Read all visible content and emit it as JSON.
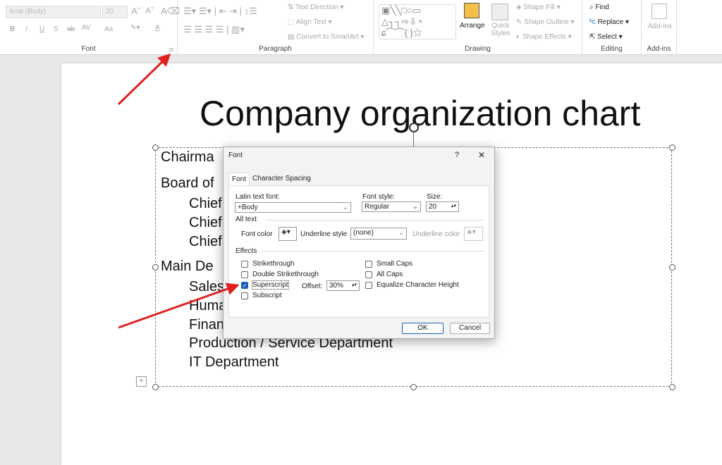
{
  "ribbon": {
    "font": {
      "font_name": "Arial (Body)",
      "font_size": "20",
      "label": "Font",
      "buttons": [
        "B",
        "I",
        "U",
        "S",
        "ab",
        "AV",
        "Aa",
        "A"
      ]
    },
    "paragraph": {
      "label": "Paragraph",
      "text_direction": "Text Direction",
      "align_text": "Align Text",
      "convert_smartart": "Convert to SmartArt"
    },
    "drawing": {
      "label": "Drawing",
      "arrange": "Arrange",
      "quick_styles": "Quick Styles",
      "shape_fill": "Shape Fill",
      "shape_outline": "Shape Outline",
      "shape_effects": "Shape Effects"
    },
    "editing": {
      "label": "Editing",
      "find": "Find",
      "replace": "Replace",
      "select": "Select"
    },
    "addins": {
      "label": "Add-ins",
      "button": "Add-ins"
    }
  },
  "slide": {
    "title": "Company organization chart",
    "lines": [
      {
        "text": "Chairma",
        "level": 0
      },
      {
        "text": "Board of",
        "level": 0
      },
      {
        "text": "Chief",
        "level": 1
      },
      {
        "text": "Chief",
        "level": 1
      },
      {
        "text": "Chief",
        "level": 1
      },
      {
        "text": "Main De",
        "level": 0
      },
      {
        "text": "Sales",
        "level": 1
      },
      {
        "text": "Huma",
        "level": 1
      },
      {
        "text": "Finan",
        "level": 1
      },
      {
        "text": "Production / Service Department",
        "level": 1
      },
      {
        "text": "IT Department",
        "level": 1
      }
    ]
  },
  "dialog": {
    "title": "Font",
    "help": "?",
    "close": "✕",
    "tabs": [
      "Font",
      "Character Spacing"
    ],
    "latin_font_label": "Latin text font:",
    "latin_font_value": "+Body",
    "font_style_label": "Font style:",
    "font_style_value": "Regular",
    "size_label": "Size:",
    "size_value": "20",
    "all_text_label": "All text",
    "font_color_label": "Font color",
    "underline_style_label": "Underline style",
    "underline_style_value": "(none)",
    "underline_color_label": "Underline color",
    "effects_label": "Effects",
    "effects": [
      {
        "label": "Strikethrough",
        "checked": false
      },
      {
        "label": "Double Strikethrough",
        "checked": false
      },
      {
        "label": "Superscript",
        "checked": true
      },
      {
        "label": "Subscript",
        "checked": false
      },
      {
        "label": "Small Caps",
        "checked": false
      },
      {
        "label": "All Caps",
        "checked": false
      },
      {
        "label": "Equalize Character Height",
        "checked": false
      }
    ],
    "offset_label": "Offset:",
    "offset_value": "30%",
    "ok": "OK",
    "cancel": "Cancel"
  },
  "colors": {
    "arrow": "#e02020",
    "accent": "#1a5fb4"
  }
}
